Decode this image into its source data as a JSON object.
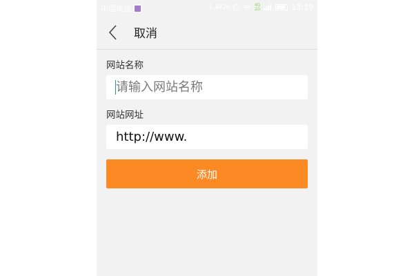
{
  "status_bar": {
    "carrier": "中国电信",
    "network_speed": "1.4K/s",
    "network_badge_top": "4G",
    "network_badge_bottom": "2G",
    "time": "13:19"
  },
  "header": {
    "back_icon": "chevron-left-icon",
    "title": "取消"
  },
  "form": {
    "site_name_label": "网站名称",
    "site_name_placeholder": "请输入网站名称",
    "site_url_label": "网站网址",
    "site_url_value": "http://www."
  },
  "actions": {
    "add_label": "添加",
    "add_color": "#fb8a24"
  }
}
